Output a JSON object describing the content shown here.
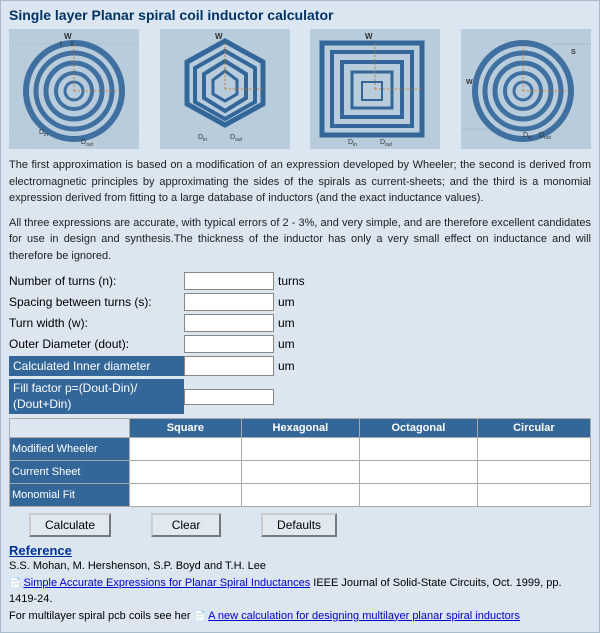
{
  "title": "Single layer Planar spiral coil inductor calculator",
  "description1": "The first approximation is based on a modification of an expression developed by Wheeler; the second is derived from electromagnetic principles by approximating the sides of the spirals as current-sheets; and the third is a monomial expression derived from fitting to a large database of inductors (and the exact inductance values).",
  "description2": "All three expressions are accurate, with typical errors of 2 - 3%, and very simple, and are therefore excellent candidates for use in design and synthesis.The thickness of the inductor has only a very small effect on inductance and will therefore be ignored.",
  "form": {
    "turns_label": "Number of turns (n):",
    "turns_unit": "turns",
    "spacing_label": "Spacing between turns (s):",
    "spacing_unit": "um",
    "width_label": "Turn width (w):",
    "width_unit": "um",
    "outer_label": "Outer Diameter (dout):",
    "outer_unit": "um",
    "inner_label": "Calculated Inner diameter",
    "inner_unit": "um",
    "fill_label": "Fill factor p=(Dout-Din)/ (Dout+Din)"
  },
  "table": {
    "col_headers": [
      "",
      "Square",
      "Hexagonal",
      "Octagonal",
      "Circular"
    ],
    "rows": [
      {
        "label": "Modified Wheeler",
        "values": [
          "",
          "",
          "",
          ""
        ]
      },
      {
        "label": "Current Sheet",
        "values": [
          "",
          "",
          "",
          ""
        ]
      },
      {
        "label": "Monomial Fit",
        "values": [
          "",
          "",
          "",
          ""
        ]
      }
    ]
  },
  "buttons": {
    "calculate": "Calculate",
    "clear": "Clear",
    "defaults": "Defaults"
  },
  "reference": {
    "title": "Reference",
    "text1": "S.S. Mohan, M. Hershenson, S.P. Boyd and T.H. Lee",
    "link1": "Simple Accurate Expressions for Planar Spiral Inductances",
    "text2": " IEEE Journal of Solid-State Circuits, Oct. 1999, pp. 1419-24.",
    "text3": "For multilayer spiral pcb coils see her",
    "link2": "A new calculation for designing multilayer planar spiral inductors"
  },
  "coil_types": [
    "circular-spiral",
    "hexagonal-spiral",
    "square-spiral",
    "circular-spiral-2"
  ]
}
